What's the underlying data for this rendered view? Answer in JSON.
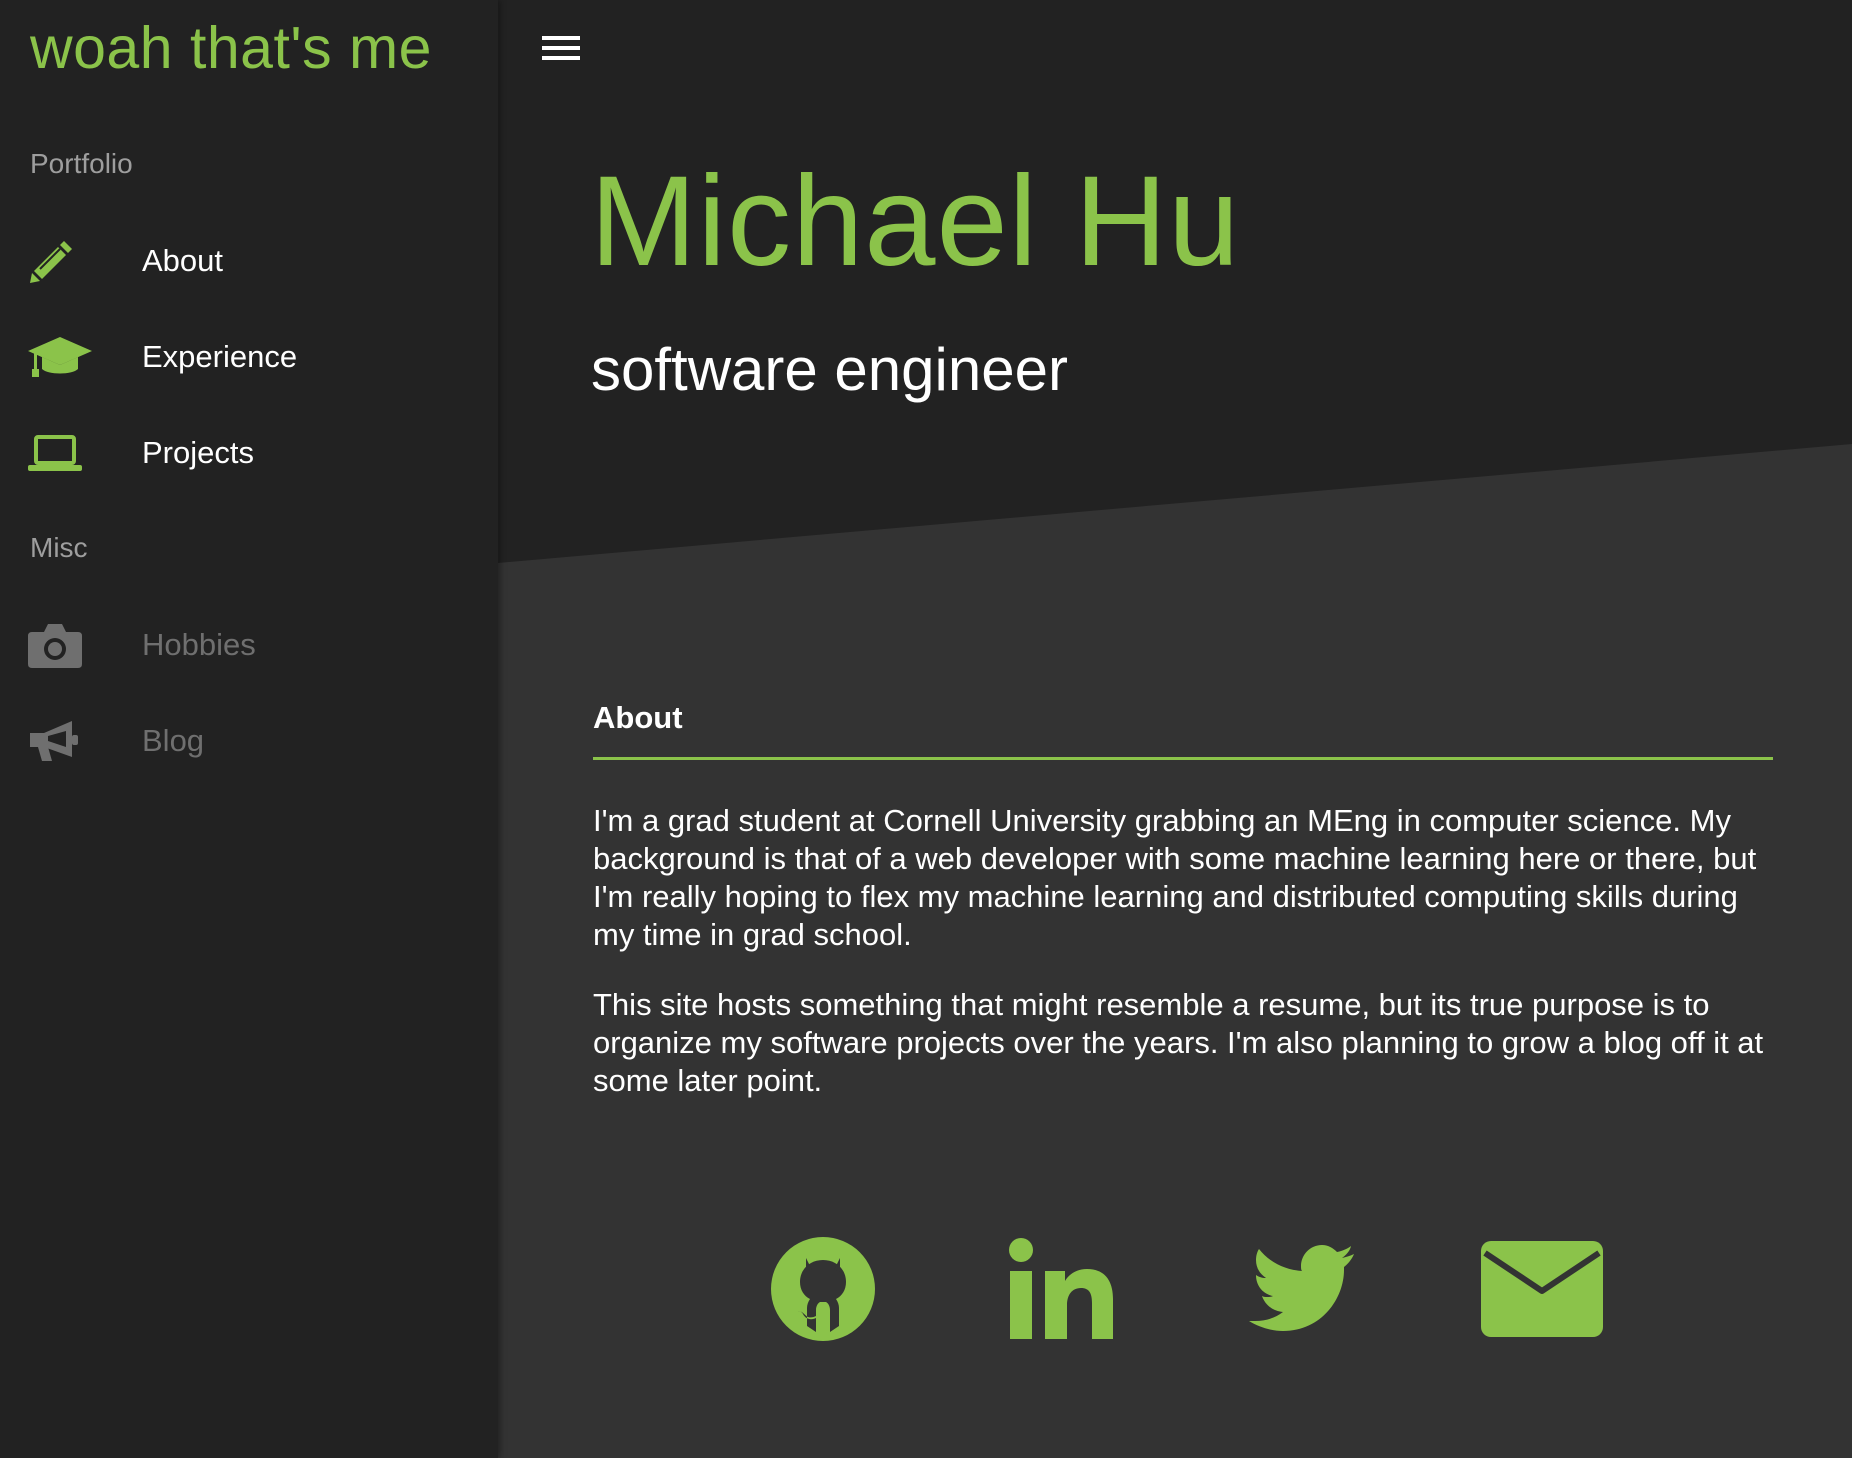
{
  "sidebar": {
    "brand": "woah that's me",
    "sections": [
      {
        "label": "Portfolio",
        "items": [
          {
            "label": "About",
            "icon": "pencil-icon"
          },
          {
            "label": "Experience",
            "icon": "graduation-cap-icon"
          },
          {
            "label": "Projects",
            "icon": "laptop-icon"
          }
        ]
      },
      {
        "label": "Misc",
        "items": [
          {
            "label": "Hobbies",
            "icon": "camera-icon",
            "disabled": true
          },
          {
            "label": "Blog",
            "icon": "megaphone-icon",
            "disabled": true
          }
        ]
      }
    ]
  },
  "hero": {
    "name": "Michael Hu",
    "title": "software engineer"
  },
  "about": {
    "heading": "About",
    "paragraphs": [
      "I'm a grad student at Cornell University grabbing an MEng in computer science. My background is that of a web developer with some machine learning here or there, but I'm really hoping to flex my machine learning and distributed computing skills during my time in grad school.",
      "This site hosts something that might resemble a resume, but its true purpose is to organize my software projects over the years. I'm also planning to grow a blog off it at some later point."
    ]
  },
  "social": [
    "github-icon",
    "linkedin-icon",
    "twitter-icon",
    "email-icon"
  ],
  "colors": {
    "accent": "#8bc34a",
    "sidebar_bg": "#222222",
    "main_bg": "#333333",
    "hero_bg": "#222222",
    "disabled_text": "#6f6f6f"
  }
}
